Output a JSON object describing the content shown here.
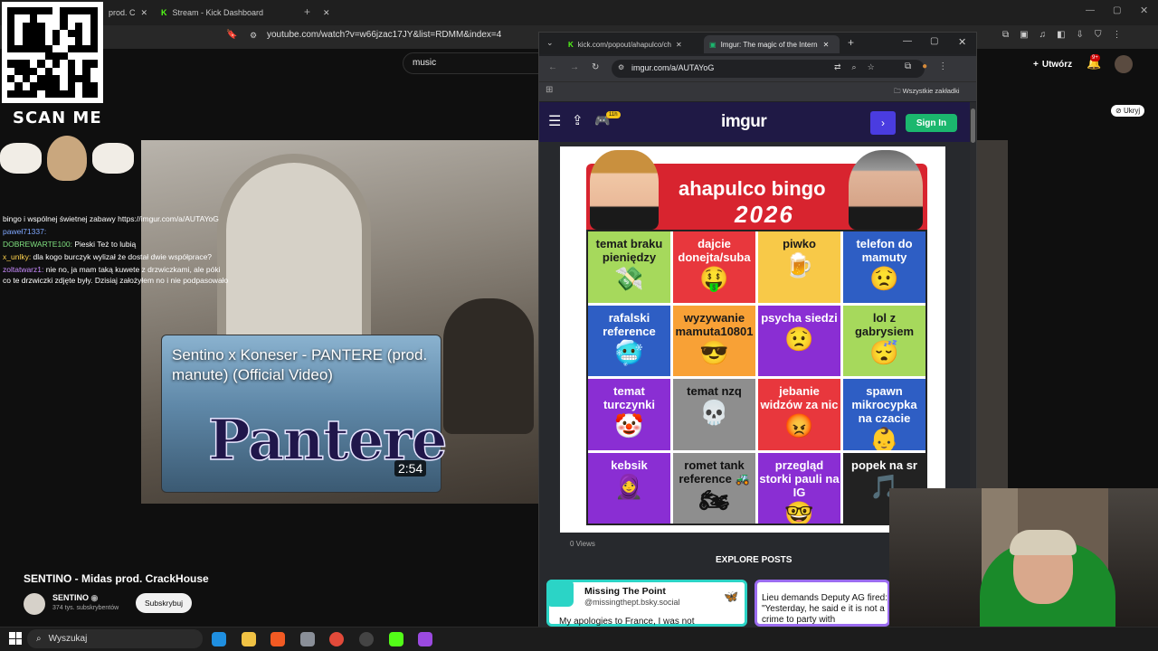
{
  "background_browser": {
    "tabs": [
      {
        "label": "prod. C"
      },
      {
        "label": "Stream - Kick Dashboard"
      }
    ],
    "url": "youtube.com/watch?v=w66jzac17JY&list=RDMM&index=4",
    "search_value": "music",
    "create_label": "Utwórz",
    "notif_badge": "9+",
    "hide_label": "Ukryj"
  },
  "overlay": {
    "scan_me": "SCAN ME",
    "chat": [
      {
        "user": "",
        "text": "bingo i wspólnej świetnej zabawy https://imgur.com/a/AUTAYoG"
      },
      {
        "user": "paweł71337:",
        "text": ""
      },
      {
        "user": "DOBREWARTE100:",
        "text": " Pieski Też to lubią"
      },
      {
        "user": "x_unlky:",
        "text": " dla kogo burczyk wylizał że dostał dwie współprace?"
      },
      {
        "user": "zoltatwarz1:",
        "text": " nie no, ja mam taką kuwete z drzwiczkami, ale póki co te drzwiczki zdjęte były. Dzisiaj założyłem no i nie podpasowało"
      }
    ]
  },
  "video_card": {
    "title": "Sentino x Koneser - PANTERE (prod. manute) (Official Video)",
    "art_text": "Pantere",
    "duration": "2:54"
  },
  "youtube_info": {
    "title": "SENTINO - Midas prod. CrackHouse",
    "channel": "SENTINO",
    "subscribers": "374 tys. subskrybentów",
    "subscribe_label": "Subskrybuj"
  },
  "popup": {
    "tabs": [
      {
        "label": "kick.com/popout/ahapulco/ch"
      },
      {
        "label": "Imgur: The magic of the Intern"
      }
    ],
    "url": "imgur.com/a/AUTAYoG",
    "bookmarks_label": "Wszystkie zakładki",
    "imgur_logo": "imgur",
    "signin_label": "Sign In",
    "gift_badge": "11h",
    "views": "0 Views",
    "explore": "EXPLORE POSTS",
    "post1": {
      "name": "Missing The Point",
      "handle": "@missingthept.bsky.social",
      "text": "My apologies to France, I was not"
    },
    "post2": {
      "text": "Lieu demands Deputy AG fired: \"Yesterday, he said e it is not a crime to party with"
    }
  },
  "bingo": {
    "title": "ahapulco bingo",
    "year": "2026",
    "cells": [
      {
        "text": "temat braku pieniędzy",
        "emoji": "💸",
        "color": "green"
      },
      {
        "text": "dajcie donejta/suba",
        "emoji": "🤑",
        "color": "red"
      },
      {
        "text": "piwko",
        "emoji": "🍺",
        "color": "yellow"
      },
      {
        "text": "telefon do mamuty",
        "emoji": "😟",
        "color": "blue"
      },
      {
        "text": "rafalski reference",
        "emoji": "🥶",
        "color": "blue"
      },
      {
        "text": "wyzywanie mamuta10801",
        "emoji": "😎",
        "color": "orange"
      },
      {
        "text": "psycha siedzi",
        "emoji": "😟",
        "color": "purple"
      },
      {
        "text": "lol z gabrysiem",
        "emoji": "😴",
        "color": "green"
      },
      {
        "text": "temat turczynki",
        "emoji": "🤡",
        "color": "purple"
      },
      {
        "text": "temat nzq",
        "emoji": "💀",
        "color": "gray"
      },
      {
        "text": "jebanie widzów za nic",
        "emoji": "😡",
        "color": "red"
      },
      {
        "text": "spawn mikrocypka na czacie",
        "emoji": "👶",
        "color": "blue"
      },
      {
        "text": "kebsik",
        "emoji": "🧕",
        "color": "purple"
      },
      {
        "text": "romet tank reference 🚜",
        "emoji": "🏍",
        "color": "gray"
      },
      {
        "text": "przegląd storki pauli na IG",
        "emoji": "🤓",
        "color": "purple"
      },
      {
        "text": "popek na sr",
        "emoji": "🎵",
        "color": "dark"
      }
    ]
  },
  "taskbar": {
    "search_label": "Wyszukaj"
  }
}
